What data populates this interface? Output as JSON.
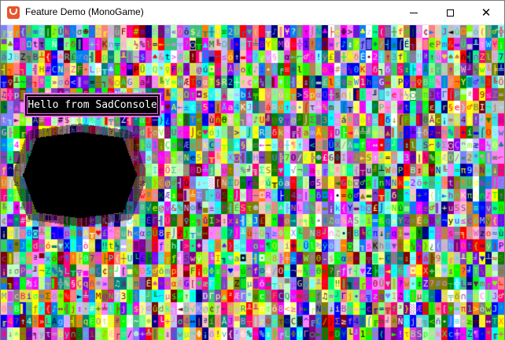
{
  "window": {
    "title": "Feature Demo (MonoGame)",
    "icon": "monogame-logo-icon",
    "controls": {
      "minimize_icon": "minimize-icon",
      "maximize_icon": "maximize-icon",
      "close_icon": "close-icon",
      "close_glyph": "✕"
    }
  },
  "console": {
    "hello_text": "Hello from SadConsole",
    "panel_border_color": "#ff6bff",
    "hole_color": "#000000",
    "glyph_set": "ABCDEFGHIJKLMNOPQRSTUVWXYZabcdefghijklmnopqrstuvwxyz0123456789!@#$%^&*()_+-=[]{}<>?/|~ÄÅÇÉæÆôöòûùÿÖÜ¢£¥₧ƒáíóúñÑªº¿⌐¬½¼¡«»░▒▓│┤╡╢╖╕╣║╗╝╜╛┐└┴┬├─┼╞╟╚╔╩╦╠═╬╧╨╤╥╙╘╒╓╫╪┘┌█▄▌▐▀αßΓπΣσµτΦΘΩδ∞φε∩≡±≥≤⌠⌡÷≈°∙·√ⁿ²■☺☻♥♦♣♠•◘○◙♂♀♪♫☼►◄↕‼¶§▬↨↑↓→←∟↔▲▼",
    "palette": [
      "#ff0000",
      "#00ff00",
      "#0000ff",
      "#ffff00",
      "#ff00ff",
      "#00ffff",
      "#ff8000",
      "#8000ff",
      "#00ff80",
      "#ff0080",
      "#80ff00",
      "#0080ff",
      "#ffffff",
      "#808080",
      "#c0c0c0",
      "#800000",
      "#008000",
      "#000080",
      "#808000",
      "#800080",
      "#008080",
      "#ff8080",
      "#80ff80",
      "#8080ff",
      "#ffff80",
      "#ff80ff",
      "#80ffff",
      "#c08040",
      "#40c080",
      "#8040c0",
      "#e0e040",
      "#40e0e0",
      "#e040e0",
      "#ffc0c0",
      "#c0ffc0",
      "#c0c0ff"
    ]
  }
}
